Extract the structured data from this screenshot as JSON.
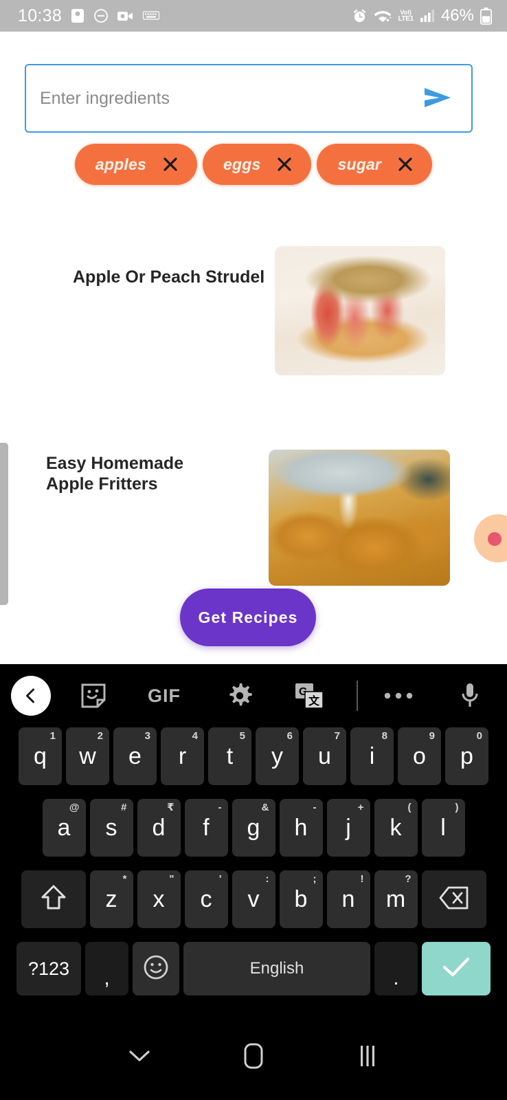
{
  "status_bar": {
    "time": "10:38",
    "battery_percent": "46%",
    "network_label_top": "VoI)",
    "network_label_bottom": "LTE1",
    "left_icons": [
      "screen-record-icon",
      "do-not-disturb-icon",
      "video-camera-icon",
      "keyboard-icon"
    ],
    "right_icons": [
      "alarm-icon",
      "wifi-icon",
      "volte-icon",
      "signal-bars-icon",
      "battery-icon"
    ],
    "background_color": "#b8b8b8"
  },
  "app": {
    "search": {
      "placeholder": "Enter ingredients",
      "value": "",
      "send_label": "send-icon",
      "border_color": "#3d9ae2"
    },
    "chips": [
      {
        "label": "apples",
        "remove_label": "✕"
      },
      {
        "label": "eggs",
        "remove_label": "✕"
      },
      {
        "label": "sugar",
        "remove_label": "✕"
      }
    ],
    "chip_color": "#f4713f",
    "recipes": [
      {
        "title": "Apple Or Peach Strudel",
        "image_name": "apple-peach-strudel-photo"
      },
      {
        "title": "Easy Homemade Apple Fritters",
        "image_name": "apple-fritters-photo"
      }
    ],
    "get_recipes_button": "Get Recipes",
    "get_recipes_color": "#6b35c9"
  },
  "keyboard": {
    "toolbar": [
      {
        "name": "back-chevron-icon"
      },
      {
        "name": "sticker-icon"
      },
      {
        "name": "gif-icon",
        "label": "GIF"
      },
      {
        "name": "gear-icon"
      },
      {
        "name": "translate-icon"
      },
      {
        "name": "more-options-icon"
      },
      {
        "name": "microphone-icon"
      }
    ],
    "row1": [
      {
        "key": "q",
        "sup": "1"
      },
      {
        "key": "w",
        "sup": "2"
      },
      {
        "key": "e",
        "sup": "3"
      },
      {
        "key": "r",
        "sup": "4"
      },
      {
        "key": "t",
        "sup": "5"
      },
      {
        "key": "y",
        "sup": "6"
      },
      {
        "key": "u",
        "sup": "7"
      },
      {
        "key": "i",
        "sup": "8"
      },
      {
        "key": "o",
        "sup": "9"
      },
      {
        "key": "p",
        "sup": "0"
      }
    ],
    "row2": [
      {
        "key": "a",
        "sup": "@"
      },
      {
        "key": "s",
        "sup": "#"
      },
      {
        "key": "d",
        "sup": "₹"
      },
      {
        "key": "f",
        "sup": "-"
      },
      {
        "key": "g",
        "sup": "&"
      },
      {
        "key": "h",
        "sup": "-"
      },
      {
        "key": "j",
        "sup": "+"
      },
      {
        "key": "k",
        "sup": "("
      },
      {
        "key": "l",
        "sup": ")"
      }
    ],
    "row3": [
      {
        "key": "z",
        "sup": "*"
      },
      {
        "key": "x",
        "sup": "\""
      },
      {
        "key": "c",
        "sup": "'"
      },
      {
        "key": "v",
        "sup": ":"
      },
      {
        "key": "b",
        "sup": ";"
      },
      {
        "key": "n",
        "sup": "!"
      },
      {
        "key": "m",
        "sup": "?"
      }
    ],
    "shift_label": "shift-icon",
    "backspace_label": "backspace-icon",
    "row4": {
      "symbols": "?123",
      "comma": ",",
      "emoji": "emoji-icon",
      "space": "English",
      "period": ".",
      "enter": "checkmark-icon"
    },
    "enter_color": "#8fd6cb"
  },
  "nav_bar": {
    "back": "chevron-down-icon",
    "home": "home-icon",
    "recents": "recent-apps-icon"
  }
}
